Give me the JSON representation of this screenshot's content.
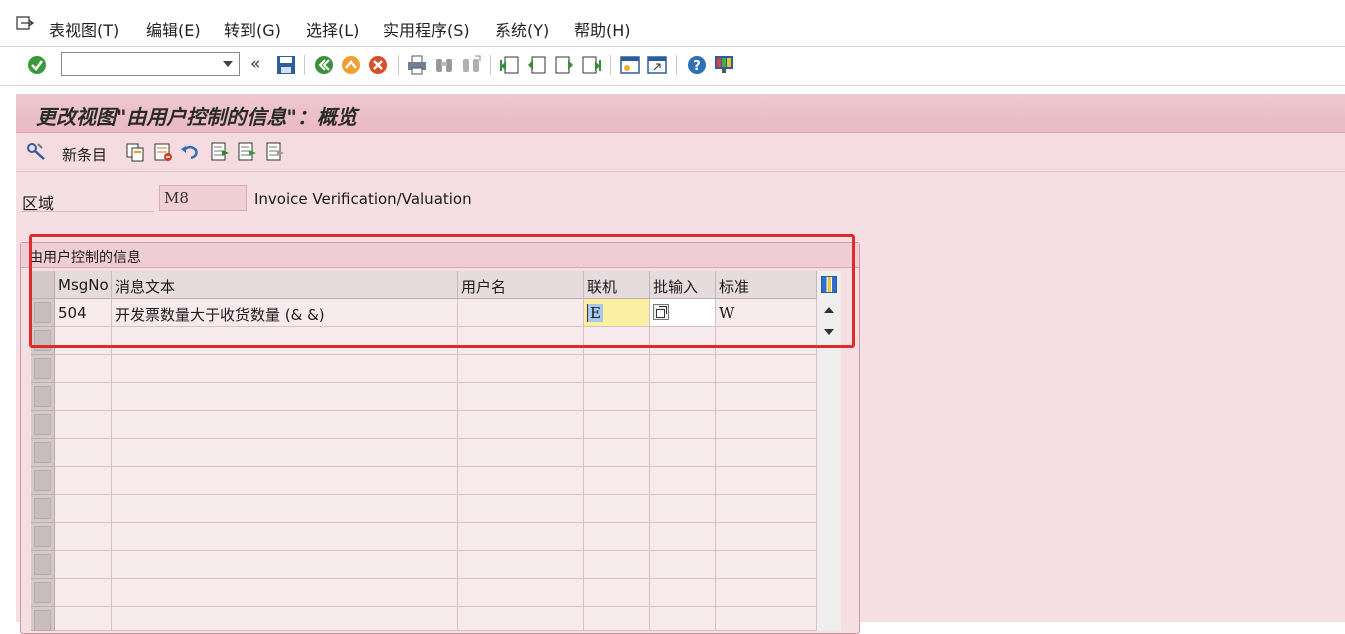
{
  "menubar": {
    "items": [
      {
        "label": "表视图(T)"
      },
      {
        "label": "编辑(E)"
      },
      {
        "label": "转到(G)"
      },
      {
        "label": "选择(L)"
      },
      {
        "label": "实用程序(S)"
      },
      {
        "label": "系统(Y)"
      },
      {
        "label": "帮助(H)"
      }
    ]
  },
  "toolbar": {
    "command_field_value": ""
  },
  "screen": {
    "title": "更改视图\"由用户控制的信息\"：概览"
  },
  "app_toolbar": {
    "new_entries_label": "新条目"
  },
  "area": {
    "label": "区域",
    "value": "M8",
    "description": "Invoice Verification/Valuation"
  },
  "group": {
    "title": "由用户控制的信息"
  },
  "table": {
    "columns": [
      {
        "label": "MsgNo"
      },
      {
        "label": "消息文本"
      },
      {
        "label": "用户名"
      },
      {
        "label": "联机"
      },
      {
        "label": "批输入"
      },
      {
        "label": "标准"
      }
    ],
    "rows": [
      {
        "msgno": "504",
        "text": "开发票数量大于收货数量 (& &)",
        "user": "",
        "online": "E",
        "batch": "",
        "standard": "W"
      }
    ]
  },
  "colors": {
    "accent_pink": "#e9b9c3",
    "panel_bg": "#f5dfe3",
    "highlight_red": "#e02b2b",
    "focus_yellow": "#fbf0a2"
  }
}
